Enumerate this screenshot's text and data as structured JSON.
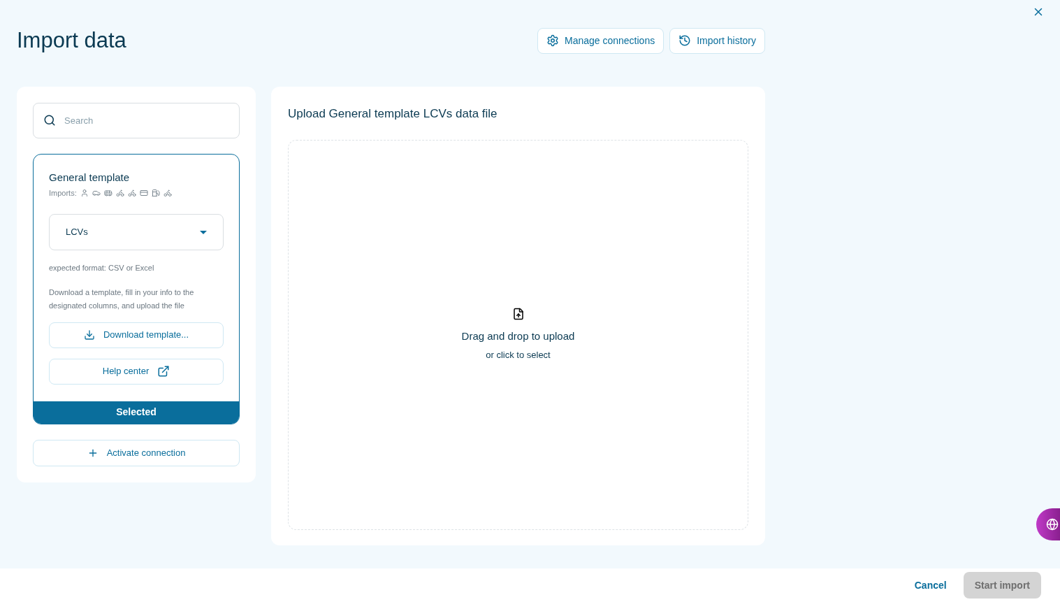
{
  "title": "Import data",
  "header_buttons": [
    {
      "kind": "gear",
      "label": "Manage connections"
    },
    {
      "kind": "history",
      "label": "Import history"
    }
  ],
  "search": {
    "placeholder": "Search"
  },
  "template": {
    "title": "General template",
    "imports_label": "Imports:",
    "dropdown": {
      "value": "LCVs"
    },
    "format": "expected format: CSV or Excel",
    "description": "Download a template, fill in your info to the designated columns, and upload the file",
    "download": "Download template...",
    "help": "Help center",
    "selected": true,
    "selected_label": "Selected"
  },
  "activate": "Activate connection",
  "upload": {
    "title": "Upload General template LCVs data file",
    "main": "Drag and drop to upload",
    "sub": "or click to select"
  },
  "footer": {
    "cancel": "Cancel",
    "start": {
      "label": "Start import",
      "disabled": true
    }
  }
}
